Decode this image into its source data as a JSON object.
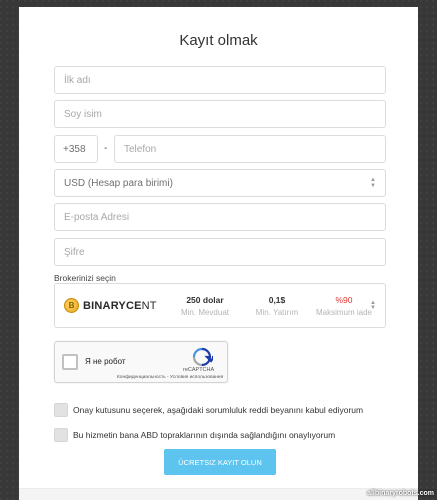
{
  "form": {
    "title": "Kayıt olmak",
    "first_name_placeholder": "İlk adı",
    "last_name_placeholder": "Soy isim",
    "phone_code": "+358",
    "phone_separator": "-",
    "phone_placeholder": "Telefon",
    "currency_value": "USD (Hesap para birimi)",
    "email_placeholder": "E-posta Adresi",
    "password_placeholder": "Şifre",
    "broker_label": "Brokerinizi seçin",
    "broker": {
      "logo_bold": "BINARYCE",
      "logo_light": "NT",
      "coin_symbol": "B",
      "min_deposit_value": "250 dolar",
      "min_deposit_label": "Min. Mevduat",
      "min_investment_value": "0,1$",
      "min_investment_label": "Min. Yatırım",
      "max_return_value": "%90",
      "max_return_label": "Maksimum iade"
    },
    "captcha": {
      "label": "Я не робот",
      "brand": "reCAPTCHA",
      "links": "Конфиденциальность - Условия использования"
    },
    "checkbox_disclaimer": "Onay kutusunu seçerek, aşağıdaki sorumluluk reddi beyanını kabul ediyorum",
    "checkbox_us": "Bu hizmetin bana ABD topraklarının dışında sağlandığını onaylıyorum",
    "submit_label": "ÜCRETSIZ KAYIT OLUN"
  },
  "watermark": "allbinaryrobots.com",
  "colors": {
    "submit": "#5dc4f0",
    "max_return": "#e3362f",
    "backdrop": "#383838"
  }
}
